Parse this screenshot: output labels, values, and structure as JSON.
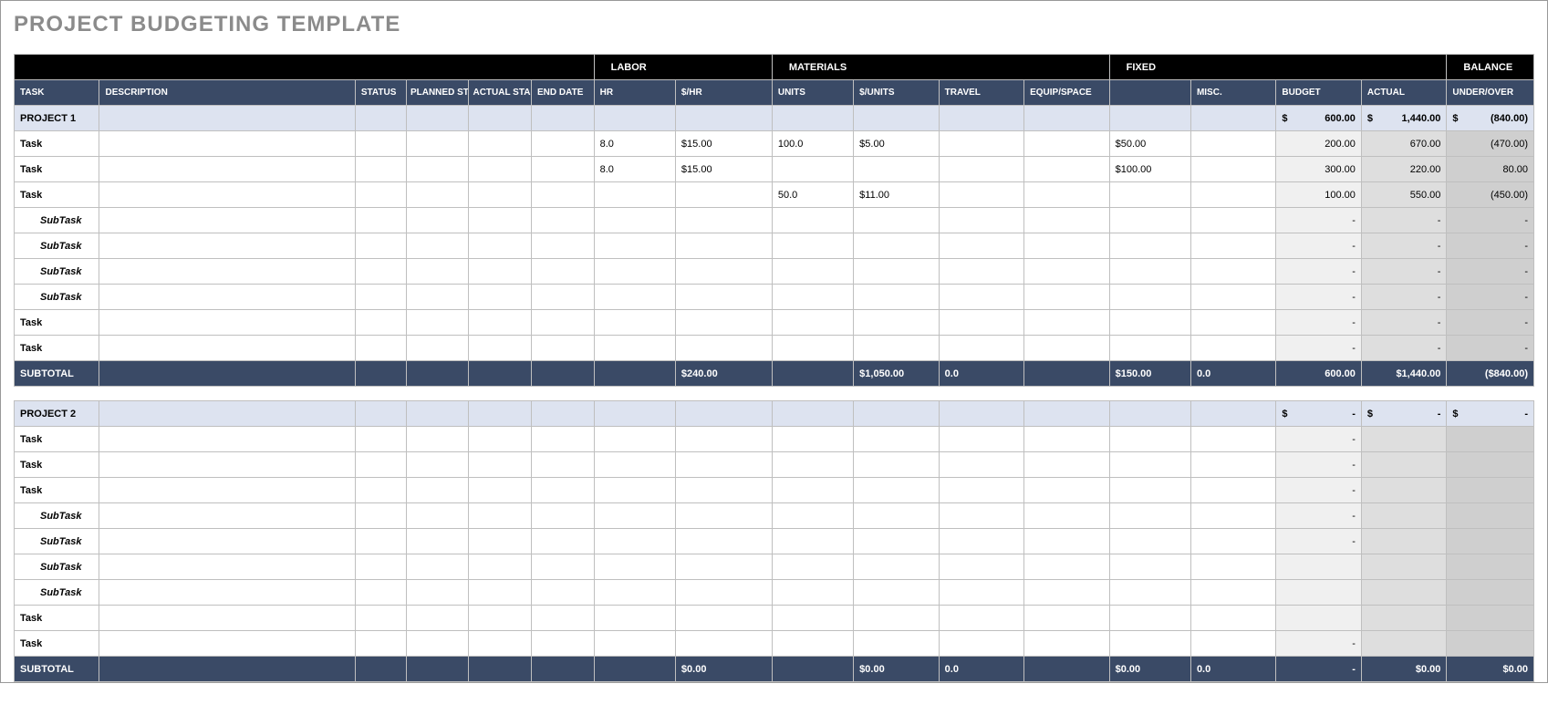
{
  "title": "PROJECT BUDGETING TEMPLATE",
  "group_headers": {
    "labor": "LABOR",
    "materials": "MATERIALS",
    "fixed": "FIXED",
    "balance": "BALANCE"
  },
  "columns": {
    "task": "TASK",
    "description": "DESCRIPTION",
    "status": "STATUS",
    "planned_start": "PLANNED START DATE",
    "actual_start": "ACTUAL START DATE",
    "end_date": "END DATE",
    "hr": "HR",
    "per_hr": "$/HR",
    "units": "UNITS",
    "per_units": "$/UNITS",
    "travel": "TRAVEL",
    "equip": "EQUIP/SPACE",
    "fixed_blank": "",
    "misc": "MISC.",
    "budget": "BUDGET",
    "actual": "ACTUAL",
    "under_over": "UNDER/OVER"
  },
  "projects": [
    {
      "name": "PROJECT 1",
      "summary": {
        "budget_sym": "$",
        "budget": "600.00",
        "actual_sym": "$",
        "actual": "1,440.00",
        "uo_sym": "$",
        "uo": "(840.00)"
      },
      "rows": [
        {
          "type": "task",
          "label": "Task",
          "hr": "8.0",
          "per_hr": "$15.00",
          "units": "100.0",
          "per_units": "$5.00",
          "fixed": "$50.00",
          "budget": "200.00",
          "actual": "670.00",
          "uo": "(470.00)"
        },
        {
          "type": "task",
          "label": "Task",
          "hr": "8.0",
          "per_hr": "$15.00",
          "units": "",
          "per_units": "",
          "fixed": "$100.00",
          "budget": "300.00",
          "actual": "220.00",
          "uo": "80.00"
        },
        {
          "type": "task",
          "label": "Task",
          "hr": "",
          "per_hr": "",
          "units": "50.0",
          "per_units": "$11.00",
          "fixed": "",
          "budget": "100.00",
          "actual": "550.00",
          "uo": "(450.00)"
        },
        {
          "type": "subtask",
          "label": "SubTask",
          "budget": "-",
          "actual": "-",
          "uo": "-"
        },
        {
          "type": "subtask",
          "label": "SubTask",
          "budget": "-",
          "actual": "-",
          "uo": "-"
        },
        {
          "type": "subtask",
          "label": "SubTask",
          "budget": "-",
          "actual": "-",
          "uo": "-"
        },
        {
          "type": "subtask",
          "label": "SubTask",
          "budget": "-",
          "actual": "-",
          "uo": "-"
        },
        {
          "type": "task",
          "label": "Task",
          "budget": "-",
          "actual": "-",
          "uo": "-"
        },
        {
          "type": "task",
          "label": "Task",
          "budget": "-",
          "actual": "-",
          "uo": "-"
        }
      ],
      "subtotal": {
        "label": "SUBTOTAL",
        "per_hr": "$240.00",
        "per_units": "$1,050.00",
        "travel": "0.0",
        "fixed": "$150.00",
        "misc": "0.0",
        "budget": "600.00",
        "actual": "$1,440.00",
        "uo": "($840.00)"
      }
    },
    {
      "name": "PROJECT 2",
      "summary": {
        "budget_sym": "$",
        "budget": "-",
        "actual_sym": "$",
        "actual": "-",
        "uo_sym": "$",
        "uo": "-"
      },
      "rows": [
        {
          "type": "task",
          "label": "Task",
          "budget": "-",
          "actual": "",
          "uo": ""
        },
        {
          "type": "task",
          "label": "Task",
          "budget": "-",
          "actual": "",
          "uo": ""
        },
        {
          "type": "task",
          "label": "Task",
          "budget": "-",
          "actual": "",
          "uo": ""
        },
        {
          "type": "subtask",
          "label": "SubTask",
          "budget": "-",
          "actual": "",
          "uo": ""
        },
        {
          "type": "subtask",
          "label": "SubTask",
          "budget": "-",
          "actual": "",
          "uo": ""
        },
        {
          "type": "subtask",
          "label": "SubTask",
          "budget": "",
          "actual": "",
          "uo": ""
        },
        {
          "type": "subtask",
          "label": "SubTask",
          "budget": "",
          "actual": "",
          "uo": ""
        },
        {
          "type": "task",
          "label": "Task",
          "budget": "",
          "actual": "",
          "uo": ""
        },
        {
          "type": "task",
          "label": "Task",
          "budget": "-",
          "actual": "",
          "uo": ""
        }
      ],
      "subtotal": {
        "label": "SUBTOTAL",
        "per_hr": "$0.00",
        "per_units": "$0.00",
        "travel": "0.0",
        "fixed": "$0.00",
        "misc": "0.0",
        "budget": "-",
        "actual": "$0.00",
        "uo": "$0.00"
      }
    }
  ]
}
